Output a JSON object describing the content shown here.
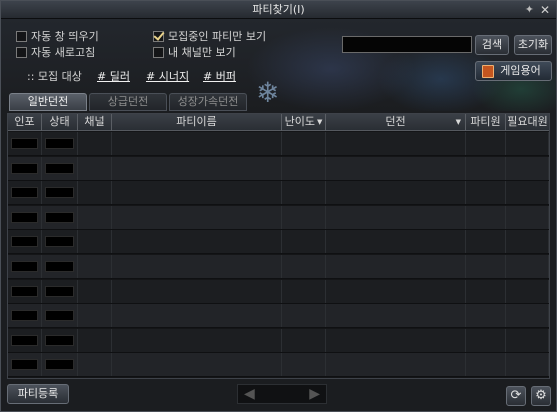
{
  "window": {
    "title": "파티찾기(I)",
    "pin_glyph": "✦",
    "close_glyph": "✕"
  },
  "options": {
    "auto_popup": "자동 창 띄우기",
    "auto_refresh": "자동 새로고침",
    "recruiting_only": "모집중인 파티만 보기",
    "my_channel_only": "내 채널만 보기",
    "recruiting_only_checked": true
  },
  "filter": {
    "label": ":: 모집 대상",
    "tags": [
      "# 딜러",
      "# 시너지",
      "# 버퍼"
    ]
  },
  "search": {
    "value": "",
    "placeholder": ""
  },
  "buttons": {
    "search": "검색",
    "reset": "초기화",
    "game_terms": "게임용어",
    "register": "파티등록"
  },
  "tabs": [
    "일반던전",
    "상급던전",
    "성장가속던전"
  ],
  "table": {
    "headers": [
      "인포",
      "상태",
      "채널",
      "파티이름",
      "난이도",
      "던전",
      "파티원",
      "필요대원"
    ],
    "sortable_headers": [
      "난이도",
      "던전"
    ],
    "row_count": 10
  },
  "pager": {
    "prev": "◀",
    "next": "▶"
  },
  "icons": {
    "refresh": "refresh-icon",
    "settings": "gear-icon",
    "book": "book-icon",
    "snowflake": "snowflake-icon"
  }
}
